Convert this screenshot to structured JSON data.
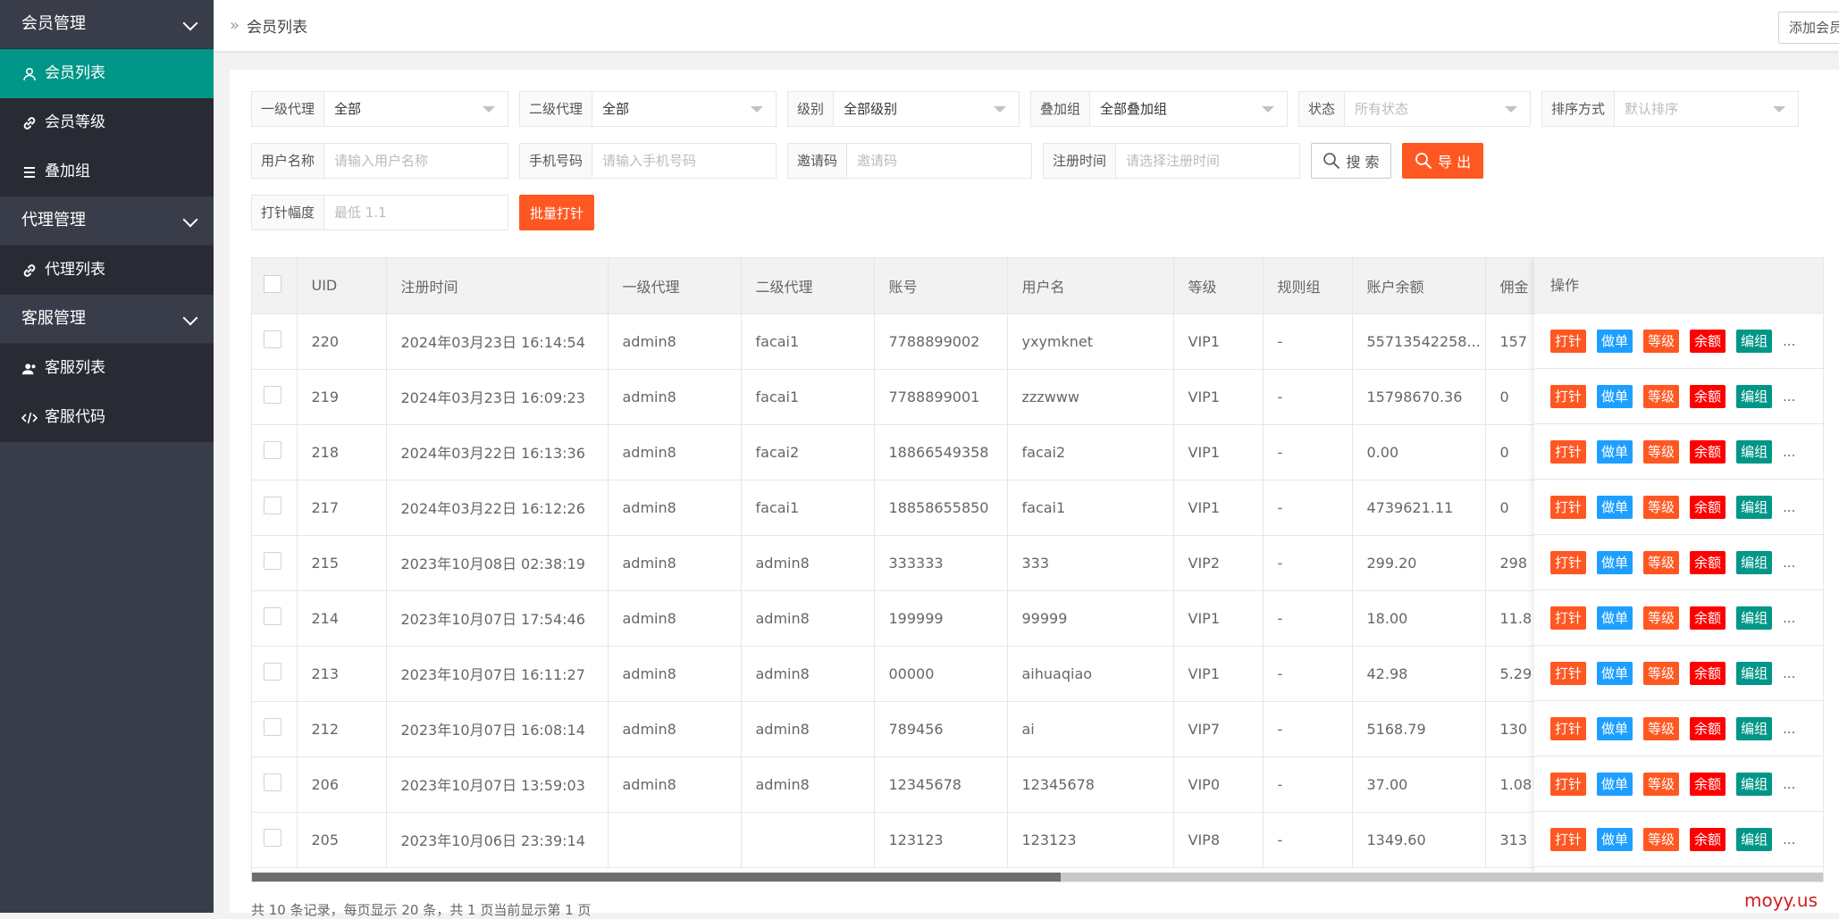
{
  "sidebar": {
    "groups": [
      {
        "label": "会员管理",
        "items": [
          {
            "label": "会员列表",
            "icon": "user-icon",
            "active": true
          },
          {
            "label": "会员等级",
            "icon": "link-icon"
          },
          {
            "label": "叠加组",
            "icon": "list-icon"
          }
        ]
      },
      {
        "label": "代理管理",
        "items": [
          {
            "label": "代理列表",
            "icon": "link-icon"
          }
        ]
      },
      {
        "label": "客服管理",
        "items": [
          {
            "label": "客服列表",
            "icon": "users-icon"
          },
          {
            "label": "客服代码",
            "icon": "code-icon"
          }
        ]
      }
    ]
  },
  "header": {
    "breadcrumb": "会员列表",
    "add_button": "添加会员"
  },
  "filters": {
    "agent1": {
      "label": "一级代理",
      "value": "全部"
    },
    "agent2": {
      "label": "二级代理",
      "value": "全部"
    },
    "level": {
      "label": "级别",
      "value": "全部级别"
    },
    "stack": {
      "label": "叠加组",
      "value": "全部叠加组"
    },
    "status": {
      "label": "状态",
      "placeholder": "所有状态"
    },
    "sort": {
      "label": "排序方式",
      "placeholder": "默认排序"
    },
    "username": {
      "label": "用户名称",
      "placeholder": "请输入用户名称"
    },
    "phone": {
      "label": "手机号码",
      "placeholder": "请输入手机号码"
    },
    "invite": {
      "label": "邀请码",
      "placeholder": "邀请码"
    },
    "regtime": {
      "label": "注册时间",
      "placeholder": "请选择注册时间"
    },
    "search_button": "搜 索",
    "export_button": "导 出",
    "pin": {
      "label": "打针幅度",
      "placeholder": "最低 1.1"
    },
    "batch_button": "批量打针"
  },
  "table": {
    "columns": [
      "UID",
      "注册时间",
      "一级代理",
      "二级代理",
      "账号",
      "用户名",
      "等级",
      "规则组",
      "账户余额",
      "佣金"
    ],
    "ops_header": "操作",
    "rows": [
      [
        "220",
        "2024年03月23日 16:14:54",
        "admin8",
        "facai1",
        "7788899002",
        "yxymknet",
        "VIP1",
        "-",
        "55713542258...",
        "157"
      ],
      [
        "219",
        "2024年03月23日 16:09:23",
        "admin8",
        "facai1",
        "7788899001",
        "zzzwww",
        "VIP1",
        "-",
        "15798670.36",
        "0"
      ],
      [
        "218",
        "2024年03月22日 16:13:36",
        "admin8",
        "facai2",
        "18866549358",
        "facai2",
        "VIP1",
        "-",
        "0.00",
        "0"
      ],
      [
        "217",
        "2024年03月22日 16:12:26",
        "admin8",
        "facai1",
        "18858655850",
        "facai1",
        "VIP1",
        "-",
        "4739621.11",
        "0"
      ],
      [
        "215",
        "2023年10月08日 02:38:19",
        "admin8",
        "admin8",
        "333333",
        "333",
        "VIP2",
        "-",
        "299.20",
        "298"
      ],
      [
        "214",
        "2023年10月07日 17:54:46",
        "admin8",
        "admin8",
        "199999",
        "99999",
        "VIP1",
        "-",
        "18.00",
        "11.8"
      ],
      [
        "213",
        "2023年10月07日 16:11:27",
        "admin8",
        "admin8",
        "00000",
        "aihuaqiao",
        "VIP1",
        "-",
        "42.98",
        "5.29"
      ],
      [
        "212",
        "2023年10月07日 16:08:14",
        "admin8",
        "admin8",
        "789456",
        "ai",
        "VIP7",
        "-",
        "5168.79",
        "130"
      ],
      [
        "206",
        "2023年10月07日 13:59:03",
        "admin8",
        "admin8",
        "12345678",
        "12345678",
        "VIP0",
        "-",
        "37.00",
        "1.08"
      ],
      [
        "205",
        "2023年10月06日 23:39:14",
        "",
        "",
        "123123",
        "123123",
        "VIP8",
        "-",
        "1349.60",
        "313"
      ]
    ],
    "actions": [
      "打针",
      "做单",
      "等级",
      "余额",
      "编组",
      "..."
    ]
  },
  "pager": {
    "text": "共 10 条记录，每页显示 20 条，共 1 页当前显示第 1 页"
  },
  "watermark": "moyy.us",
  "colors": {
    "sidebar": "#393d49",
    "active": "#009688",
    "orange": "#ff5722",
    "blue": "#1e9fff",
    "red": "#ff0000"
  }
}
